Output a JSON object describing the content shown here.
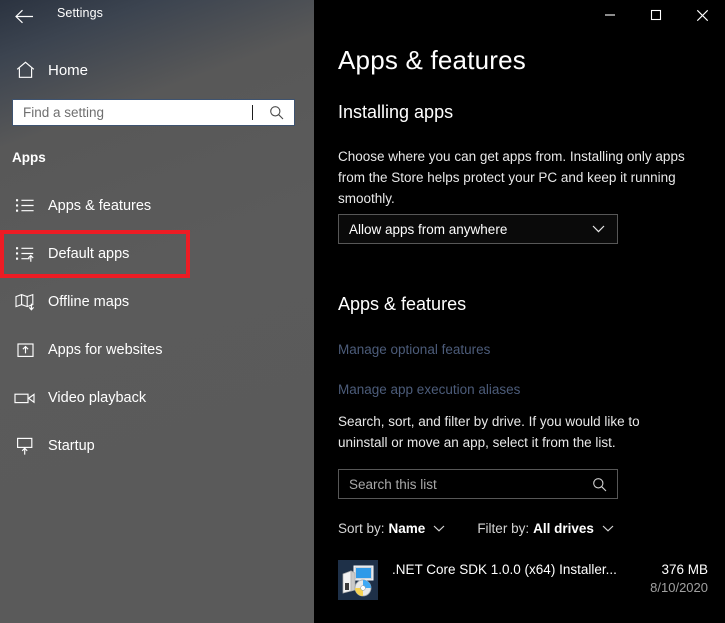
{
  "window": {
    "title": "Settings",
    "back_icon": "back-arrow-icon",
    "controls": [
      {
        "name": "minimize",
        "glyph": "—"
      },
      {
        "name": "maximize",
        "glyph": "□"
      },
      {
        "name": "close",
        "glyph": "✕"
      }
    ]
  },
  "sidebar": {
    "home_label": "Home",
    "home_icon": "home-icon",
    "search": {
      "placeholder": "Find a setting",
      "icon": "search-icon",
      "value": ""
    },
    "section_header": "Apps",
    "items": [
      {
        "label": "Apps & features",
        "icon": "list-bullet-icon",
        "highlighted": false
      },
      {
        "label": "Default apps",
        "icon": "list-arrow-icon",
        "highlighted": true
      },
      {
        "label": "Offline maps",
        "icon": "map-download-icon",
        "highlighted": false
      },
      {
        "label": "Apps for websites",
        "icon": "box-arrow-up-icon",
        "highlighted": false
      },
      {
        "label": "Video playback",
        "icon": "video-camera-icon",
        "highlighted": false
      },
      {
        "label": "Startup",
        "icon": "monitor-arrow-up-icon",
        "highlighted": false
      }
    ],
    "highlight_color": "#ed1c24"
  },
  "main": {
    "page_title": "Apps & features",
    "installing": {
      "heading": "Installing apps",
      "description": "Choose where you can get apps from. Installing only apps from the Store helps protect your PC and keep it running smoothly.",
      "dropdown_value": "Allow apps from anywhere",
      "dropdown_icon": "chevron-down-icon"
    },
    "apps_features": {
      "heading": "Apps & features",
      "links": [
        "Manage optional features",
        "Manage app execution aliases"
      ],
      "link_color": "#4c5c7a",
      "description": "Search, sort, and filter by drive. If you would like to uninstall or move an app, select it from the list.",
      "search": {
        "placeholder": "Search this list",
        "icon": "search-icon",
        "value": ""
      },
      "sort_label": "Sort by:",
      "sort_value": "Name",
      "filter_label": "Filter by:",
      "filter_value": "All drives",
      "chevron_icon": "chevron-down-icon",
      "app_list": [
        {
          "name": ".NET Core SDK 1.0.0 (x64) Installer...",
          "size": "376 MB",
          "date": "8/10/2020",
          "icon": "installer-package-icon"
        }
      ]
    }
  }
}
